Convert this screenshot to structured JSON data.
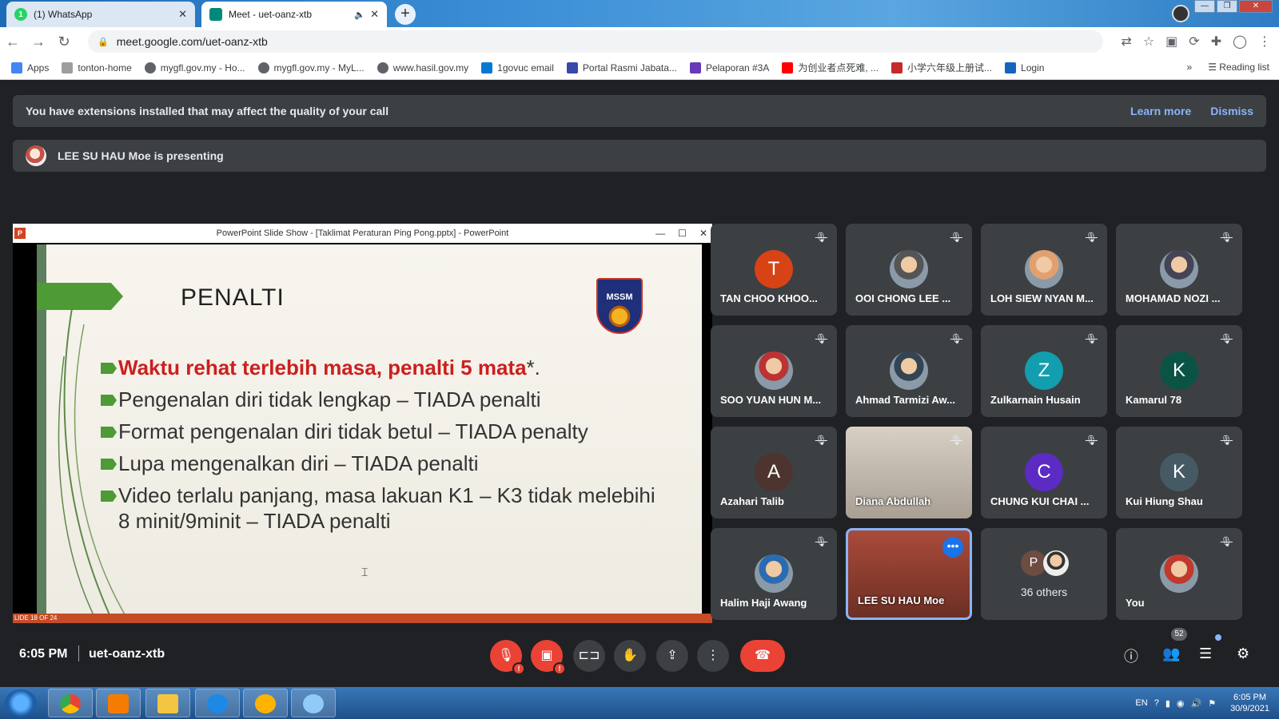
{
  "browser": {
    "tabs": [
      {
        "title": "(1) WhatsApp",
        "favicon_color": "#25d366",
        "favicon_text": "1"
      },
      {
        "title": "Meet - uet-oanz-xtb",
        "favicon_color": "#00897b",
        "favicon_text": ""
      }
    ],
    "url": "meet.google.com/uet-oanz-xtb",
    "bookmarks": [
      {
        "label": "Apps",
        "color": "#4285f4"
      },
      {
        "label": "tonton-home",
        "color": "#9e9e9e"
      },
      {
        "label": "mygfl.gov.my - Ho...",
        "color": "#5f6368"
      },
      {
        "label": "mygfl.gov.my - MyL...",
        "color": "#5f6368"
      },
      {
        "label": "www.hasil.gov.my",
        "color": "#5f6368"
      },
      {
        "label": "1govuc email",
        "color": "#0078d4"
      },
      {
        "label": "Portal Rasmi Jabata...",
        "color": "#3949ab"
      },
      {
        "label": "Pelaporan #3A",
        "color": "#673ab7"
      },
      {
        "label": "为创业者点死难, ...",
        "color": "#ff0000"
      },
      {
        "label": "小学六年级上册试...",
        "color": "#c62828"
      },
      {
        "label": "Login",
        "color": "#1565c0"
      }
    ],
    "reading_list": "Reading list",
    "overflow": "»"
  },
  "banners": {
    "extensions": "You have extensions installed that may affect the quality of your call",
    "learn_more": "Learn more",
    "dismiss": "Dismiss",
    "presenting": "LEE SU HAU Moe is presenting"
  },
  "presentation": {
    "window_title": "PowerPoint Slide Show - [Taklimat Peraturan Ping Pong.pptx] - PowerPoint",
    "slide_title": "PENALTI",
    "logo_text": "MSSM",
    "bullets": [
      {
        "main": "Waktu rehat terlebih masa, penalti 5 mata",
        "suffix": "*."
      },
      {
        "main": "Pengenalan diri tidak lengkap – TIADA penalti",
        "suffix": ""
      },
      {
        "main": "Format pengenalan diri tidak betul – TIADA penalty",
        "suffix": ""
      },
      {
        "main": "Lupa mengenalkan diri – TIADA penalti",
        "suffix": ""
      },
      {
        "main": "Video terlalu panjang, masa lakuan K1 – K3 tidak melebihi 8 minit/9minit – TIADA penalti",
        "suffix": ""
      }
    ],
    "status": "LIDE 18 OF 24"
  },
  "participants": [
    {
      "name": "TAN CHOO KHOO...",
      "initial": "T",
      "color": "#d84315",
      "type": "letter"
    },
    {
      "name": "OOI CHONG LEE ...",
      "initial": "",
      "color": "#555",
      "type": "photo"
    },
    {
      "name": "LOH SIEW NYAN M...",
      "initial": "",
      "color": "#e0a070",
      "type": "photo"
    },
    {
      "name": "MOHAMAD NOZI ...",
      "initial": "",
      "color": "#445",
      "type": "photo"
    },
    {
      "name": "SOO YUAN HUN M...",
      "initial": "",
      "color": "#b33",
      "type": "photo"
    },
    {
      "name": "Ahmad Tarmizi Aw...",
      "initial": "",
      "color": "#345",
      "type": "photo"
    },
    {
      "name": "Zulkarnain Husain",
      "initial": "Z",
      "color": "#129eaf",
      "type": "letter"
    },
    {
      "name": "Kamarul 78",
      "initial": "K",
      "color": "#0b5345",
      "type": "letter"
    },
    {
      "name": "Azahari Talib",
      "initial": "A",
      "color": "#4e342e",
      "type": "letter"
    },
    {
      "name": "Diana Abdullah",
      "initial": "",
      "color": "#ccc",
      "type": "video"
    },
    {
      "name": "CHUNG KUI CHAI ...",
      "initial": "C",
      "color": "#5b2bc4",
      "type": "letter"
    },
    {
      "name": "Kui Hiung Shau",
      "initial": "K",
      "color": "#455a64",
      "type": "letter"
    },
    {
      "name": "Halim Haji Awang",
      "initial": "",
      "color": "#2b6cb0",
      "type": "photo"
    },
    {
      "name": "LEE SU HAU Moe",
      "initial": "",
      "color": "#a94b3a",
      "type": "speaker"
    },
    {
      "name": "36 others",
      "initial": "P",
      "color": "#6d4c41",
      "type": "others"
    },
    {
      "name": "You",
      "initial": "",
      "color": "#c0392b",
      "type": "photo"
    }
  ],
  "bottombar": {
    "time": "6:05 PM",
    "meeting_code": "uet-oanz-xtb",
    "people_count": "52"
  },
  "taskbar": {
    "lang": "EN",
    "time": "6:05 PM",
    "date": "30/9/2021"
  }
}
